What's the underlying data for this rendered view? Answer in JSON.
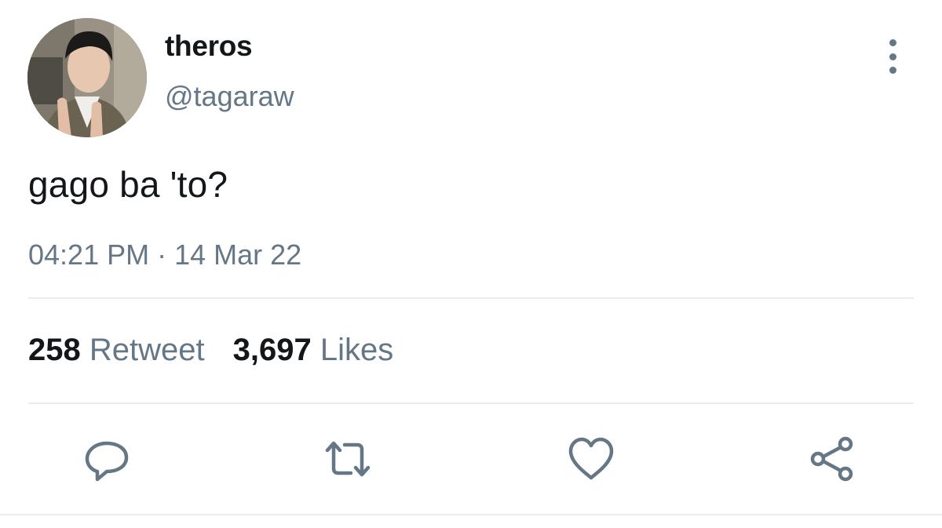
{
  "user": {
    "display_name": "theros",
    "handle": "@tagaraw"
  },
  "tweet": {
    "text": "gago ba 'to?",
    "time": "04:21 PM",
    "separator": "·",
    "date": "14 Mar 22"
  },
  "stats": {
    "retweets_count": "258",
    "retweets_label": "Retweet",
    "likes_count": "3,697",
    "likes_label": "Likes"
  },
  "icons": {
    "reply": "reply-icon",
    "retweet": "retweet-icon",
    "like": "heart-icon",
    "share": "share-icon",
    "more": "more-vertical-icon"
  },
  "colors": {
    "text_primary": "#14171a",
    "text_secondary": "#657786",
    "divider": "#e6ecf0"
  }
}
